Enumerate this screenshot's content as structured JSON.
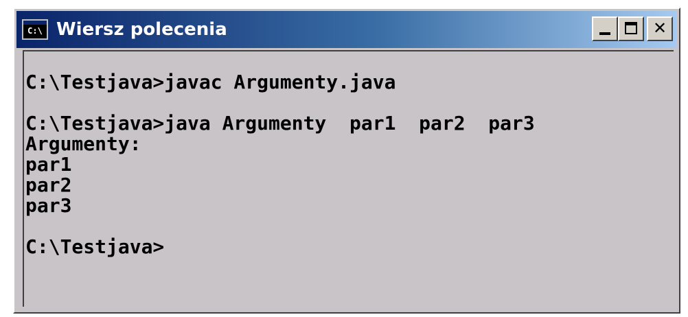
{
  "window": {
    "title": "Wiersz polecenia",
    "icon": "C:\\",
    "controls": {
      "minimize": "minimize-icon",
      "maximize": "maximize-icon",
      "close": "close-icon"
    }
  },
  "console": {
    "lines": [
      "",
      "C:\\Testjava>javac Argumenty.java",
      "",
      "C:\\Testjava>java Argumenty  par1  par2  par3",
      "Argumenty:",
      "par1",
      "par2",
      "par3",
      "",
      "C:\\Testjava>"
    ]
  },
  "colors": {
    "titlebar_start": "#0a246a",
    "titlebar_end": "#a6caf0",
    "console_bg": "#c8c4c8",
    "console_text": "#000000"
  }
}
